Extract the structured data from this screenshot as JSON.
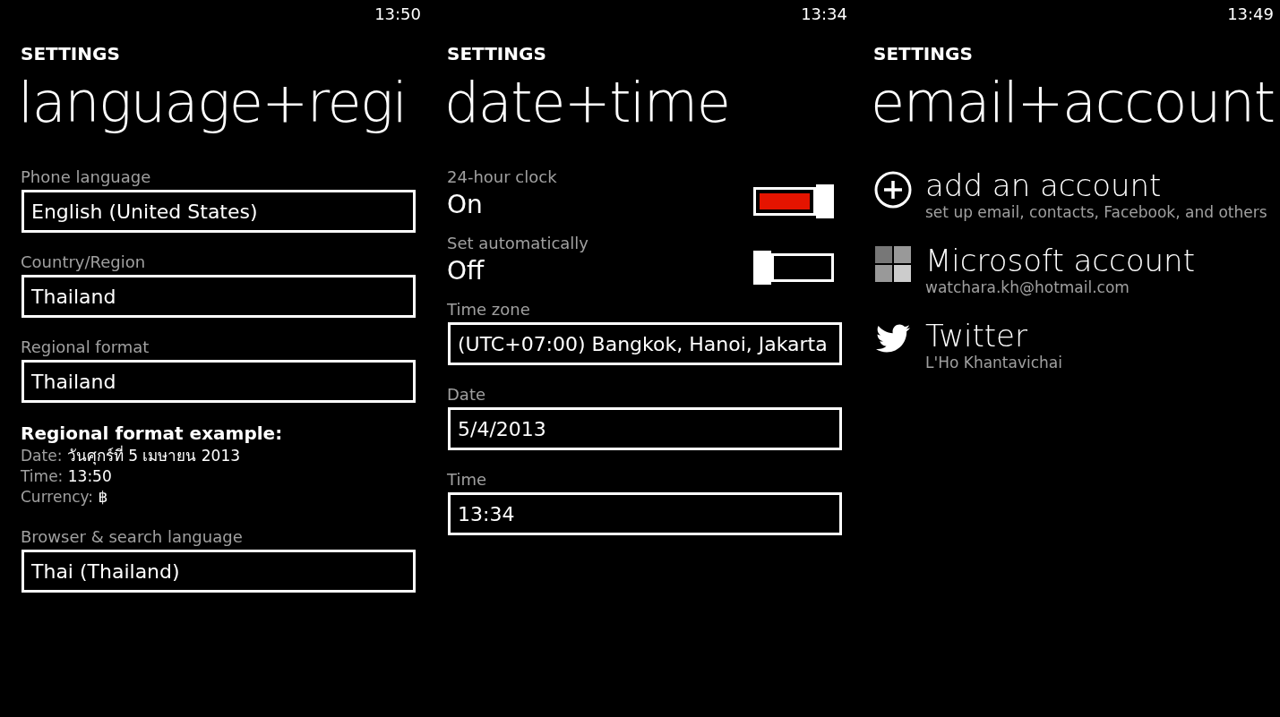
{
  "screens": [
    {
      "time": "13:50",
      "header": "SETTINGS",
      "title": "language+regi",
      "items": [
        {
          "kind": "field",
          "label": "Phone language",
          "value": "English (United States)"
        },
        {
          "kind": "field",
          "label": "Country/Region",
          "value": "Thailand"
        },
        {
          "kind": "field",
          "label": "Regional format",
          "value": "Thailand"
        },
        {
          "kind": "example",
          "heading": "Regional format example:",
          "lines": [
            {
              "label": "Date:",
              "value": "วันศุกร์ที่ 5 เมษายน 2013"
            },
            {
              "label": "Time:",
              "value": "13:50"
            },
            {
              "label": "Currency:",
              "value": "฿"
            }
          ]
        },
        {
          "kind": "field",
          "label": "Browser & search language",
          "value": "Thai (Thailand)"
        }
      ]
    },
    {
      "time": "13:34",
      "header": "SETTINGS",
      "title": "date+time",
      "items": [
        {
          "kind": "toggle",
          "label": "24-hour clock",
          "state_text": "On",
          "on": true
        },
        {
          "kind": "toggle",
          "label": "Set automatically",
          "state_text": "Off",
          "on": false
        },
        {
          "kind": "field",
          "label": "Time zone",
          "value": "(UTC+07:00) Bangkok, Hanoi, Jakarta"
        },
        {
          "kind": "field",
          "label": "Date",
          "value": "5/4/2013"
        },
        {
          "kind": "field",
          "label": "Time",
          "value": "13:34"
        }
      ]
    },
    {
      "time": "13:49",
      "header": "SETTINGS",
      "title": "email+account",
      "items": [
        {
          "kind": "account",
          "name": "add an account",
          "detail": "set up email, contacts, Facebook, and others"
        },
        {
          "kind": "account",
          "name": "Microsoft account",
          "detail": "watchara.kh@hotmail.com"
        },
        {
          "kind": "account",
          "name": "Twitter",
          "detail": "L'Ho Khantavichai"
        }
      ]
    }
  ]
}
